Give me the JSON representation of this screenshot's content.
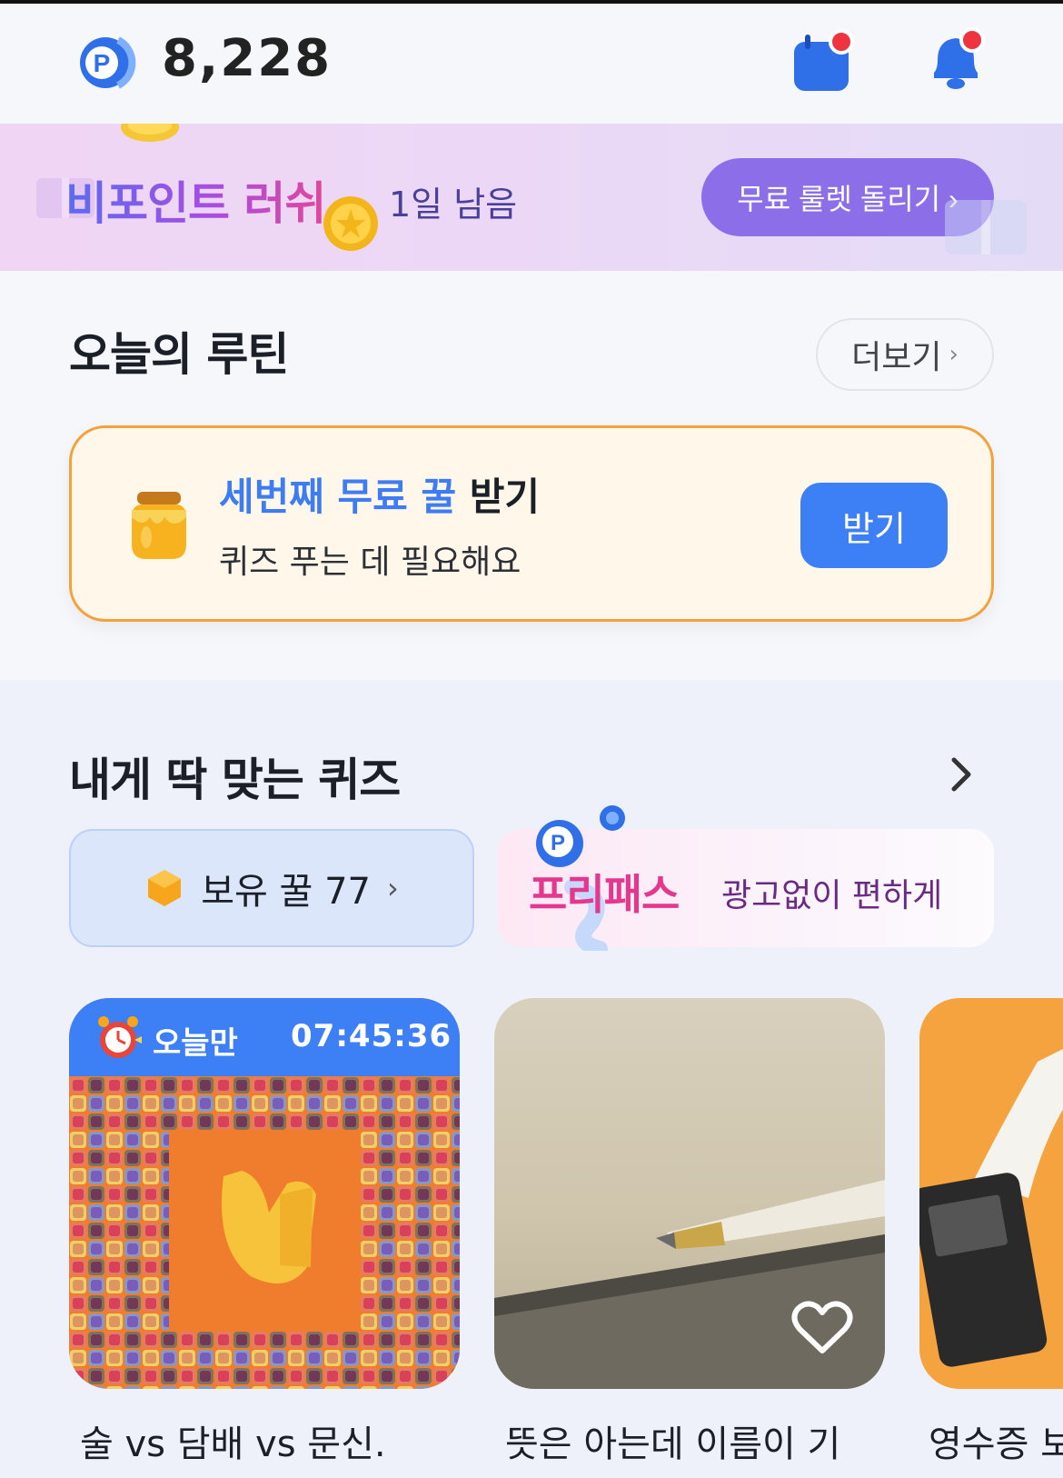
{
  "header": {
    "points": "8,228",
    "points_icon": "p-coin-icon",
    "calendar_icon": "calendar-icon",
    "bell_icon": "bell-icon"
  },
  "promo": {
    "title": "비포인트 러쉬",
    "remaining": "1일 남음",
    "button": "무료 룰렛 돌리기 ›"
  },
  "routine": {
    "title": "오늘의 루틴",
    "more": "더보기",
    "card": {
      "title_highlight": "세번째 무료 꿀",
      "title_rest": " 받기",
      "subtitle": "퀴즈 푸는 데 필요해요",
      "button": "받기"
    }
  },
  "quiz": {
    "title": "내게 딱 맞는 퀴즈",
    "honey_label": "보유 꿀 77",
    "freepass_title": "프리패스",
    "freepass_desc": "광고없이 편하게",
    "cards": [
      {
        "banner_label": "오늘만",
        "banner_time": "07:45:36",
        "caption": "술 vs 담배 vs 문신."
      },
      {
        "caption": "뜻은 아는데 이름이 기"
      },
      {
        "caption": "영수증 보"
      }
    ]
  },
  "colors": {
    "accent_blue": "#3d7ff4",
    "orange_border": "#f3a13a",
    "promo_button": "#8c6ee9",
    "notification_dot": "#f0343f"
  }
}
